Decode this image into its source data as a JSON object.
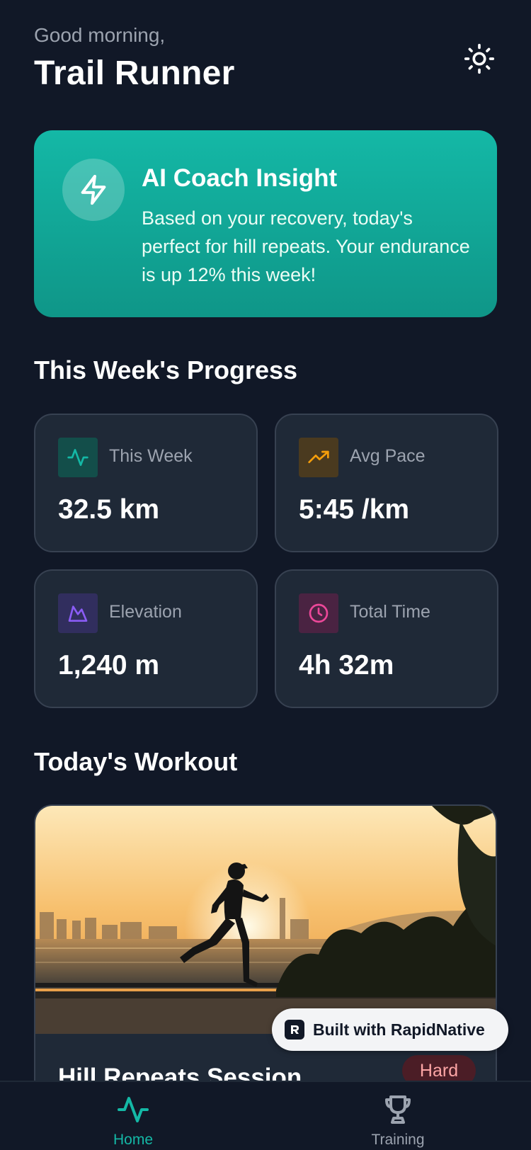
{
  "header": {
    "greeting": "Good morning,",
    "title": "Trail Runner",
    "theme_icon": "sun-icon"
  },
  "coach": {
    "title": "AI Coach Insight",
    "text": "Based on your recovery, today's perfect for hill repeats. Your endurance is up 12% this week!",
    "icon": "lightning-icon"
  },
  "progress": {
    "section_title": "This Week's Progress",
    "stats": [
      {
        "label": "This Week",
        "value": "32.5 km",
        "icon": "activity-pulse-icon",
        "color": "#14b8a6"
      },
      {
        "label": "Avg Pace",
        "value": "5:45 /km",
        "icon": "trending-up-icon",
        "color": "#f59e0b"
      },
      {
        "label": "Elevation",
        "value": "1,240 m",
        "icon": "mountain-icon",
        "color": "#8b5cf6"
      },
      {
        "label": "Total Time",
        "value": "4h 32m",
        "icon": "clock-icon",
        "color": "#ec4899"
      }
    ]
  },
  "workout": {
    "section_title": "Today's Workout",
    "name": "Hill Repeats Session",
    "difficulty": "Hard"
  },
  "badge": {
    "text": "Built with RapidNative"
  },
  "tabs": [
    {
      "label": "Home",
      "icon": "activity-pulse-icon",
      "active": true
    },
    {
      "label": "Training",
      "icon": "trophy-icon",
      "active": false
    }
  ],
  "colors": {
    "background": "#111827",
    "card": "#1f2937",
    "accent": "#14b8a6",
    "muted_text": "#9ca3af"
  }
}
